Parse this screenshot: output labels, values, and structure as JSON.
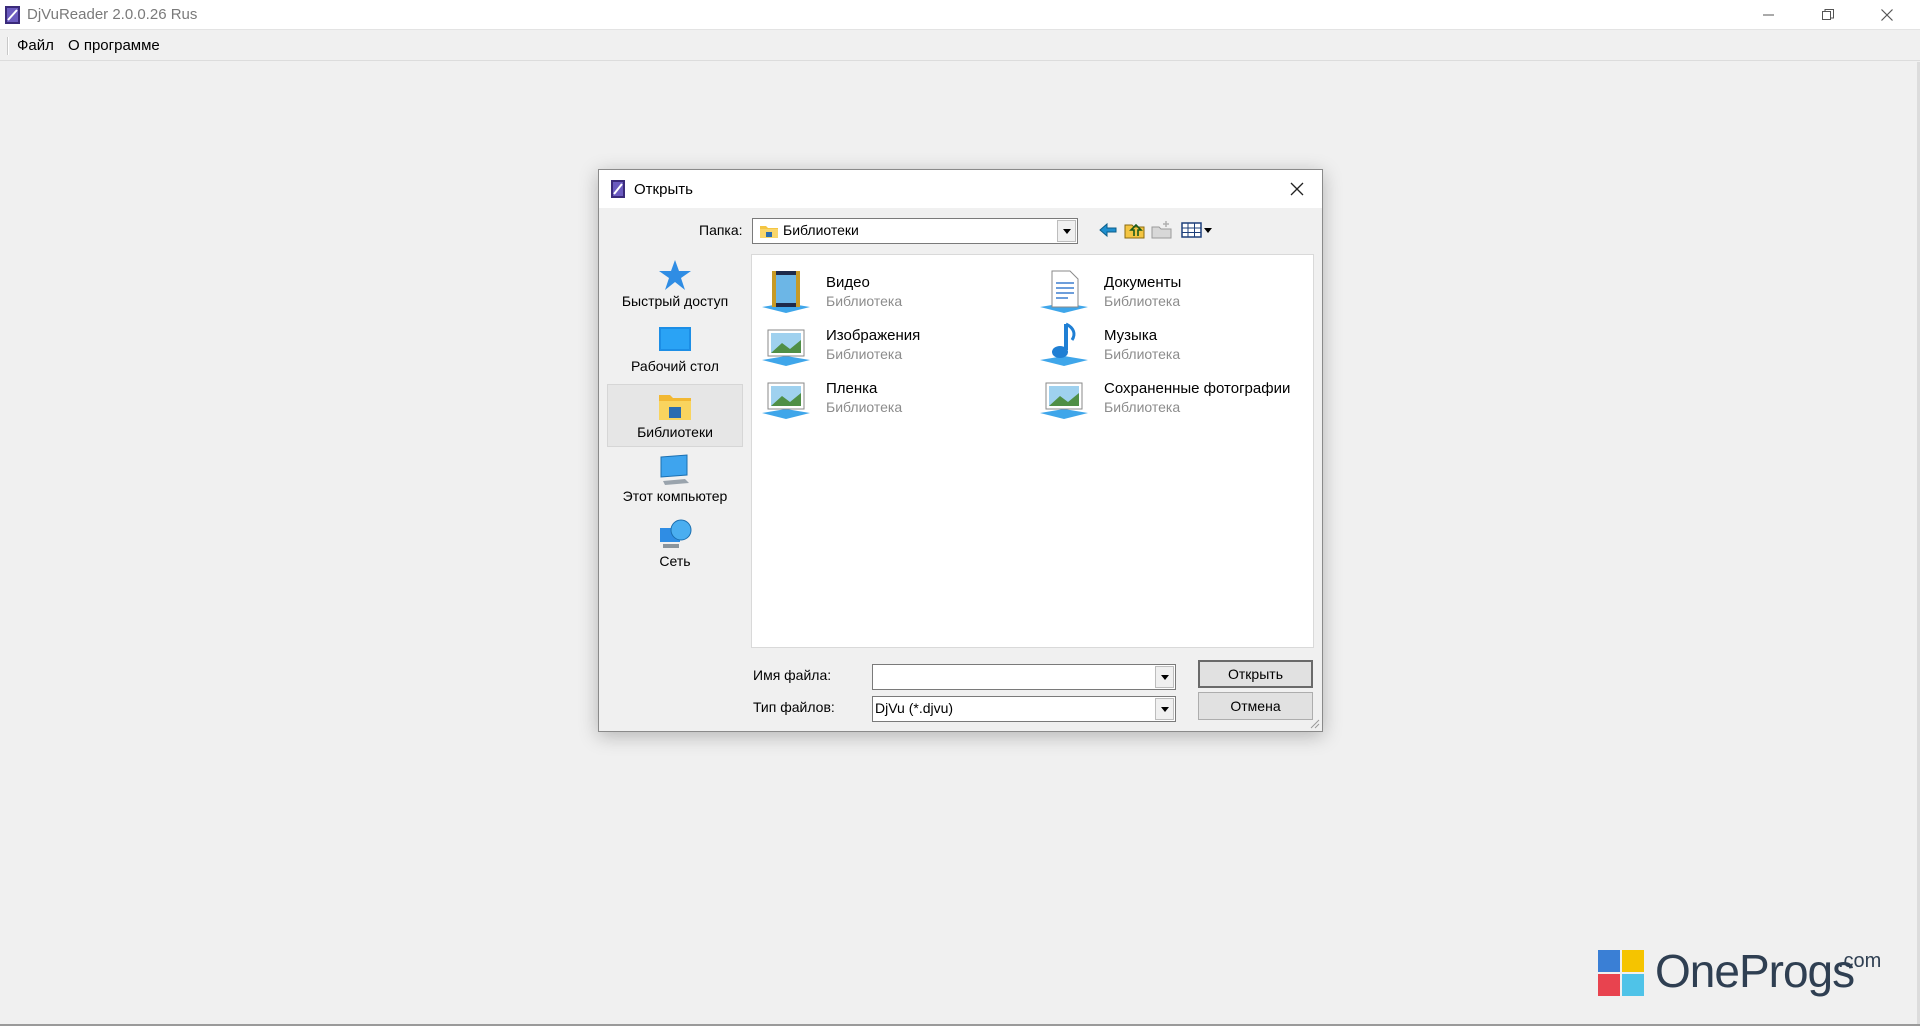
{
  "window": {
    "title": "DjVuReader 2.0.0.26 Rus",
    "menu": [
      {
        "label": "Файл"
      },
      {
        "label": "О программе"
      }
    ]
  },
  "dialog": {
    "title": "Открыть",
    "folder_label": "Папка:",
    "folder_value": "Библиотеки",
    "places": [
      {
        "label": "Быстрый доступ",
        "icon": "star-icon"
      },
      {
        "label": "Рабочий стол",
        "icon": "desktop-icon"
      },
      {
        "label": "Библиотеки",
        "icon": "libraries-icon",
        "selected": true
      },
      {
        "label": "Этот компьютер",
        "icon": "computer-icon"
      },
      {
        "label": "Сеть",
        "icon": "network-icon"
      }
    ],
    "items": [
      {
        "name": "Видео",
        "kind": "Библиотека",
        "icon": "video-library-icon"
      },
      {
        "name": "Документы",
        "kind": "Библиотека",
        "icon": "documents-library-icon"
      },
      {
        "name": "Изображения",
        "kind": "Библиотека",
        "icon": "pictures-library-icon"
      },
      {
        "name": "Музыка",
        "kind": "Библиотека",
        "icon": "music-library-icon"
      },
      {
        "name": "Пленка",
        "kind": "Библиотека",
        "icon": "camera-roll-library-icon"
      },
      {
        "name": "Сохраненные фотографии",
        "kind": "Библиотека",
        "icon": "saved-pictures-library-icon"
      }
    ],
    "filename_label": "Имя файла:",
    "filename_value": "",
    "filetype_label": "Тип файлов:",
    "filetype_value": "DjVu (*.djvu)",
    "open_button": "Открыть",
    "cancel_button": "Отмена"
  },
  "watermark": {
    "text": "OneProgs",
    "suffix": ".com"
  }
}
